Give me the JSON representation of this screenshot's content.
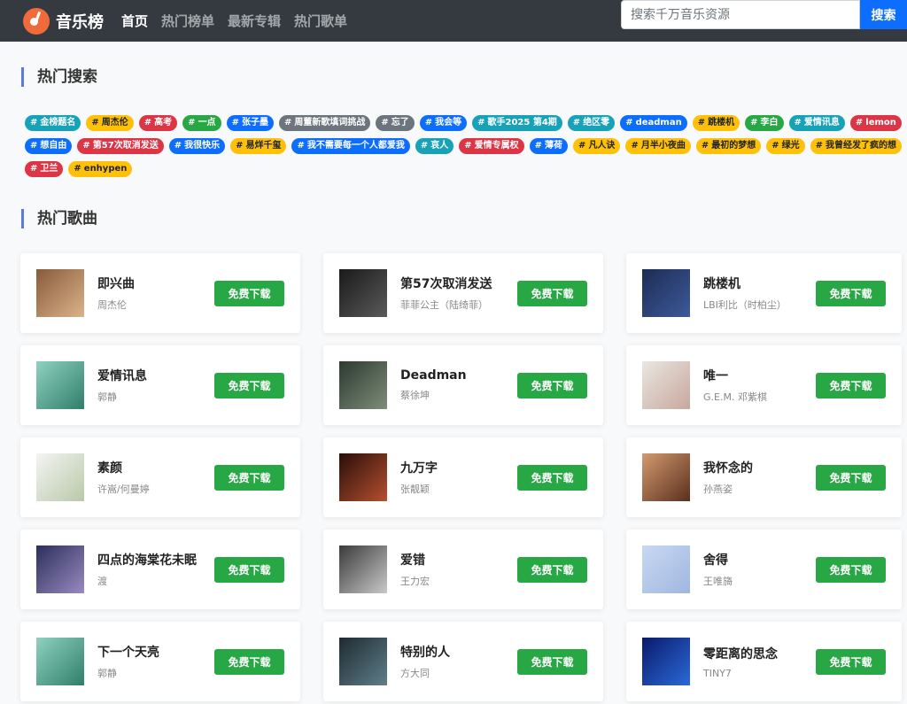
{
  "header": {
    "brand": "音乐榜",
    "nav": [
      {
        "label": "首页",
        "active": true
      },
      {
        "label": "热门榜单",
        "active": false
      },
      {
        "label": "最新专辑",
        "active": false
      },
      {
        "label": "热门歌单",
        "active": false
      }
    ],
    "search": {
      "placeholder": "搜索千万音乐资源",
      "button": "搜索"
    }
  },
  "hot_search": {
    "title": "热门搜索",
    "tags": [
      {
        "text": "金榜题名",
        "color": "teal"
      },
      {
        "text": "周杰伦",
        "color": "yellow"
      },
      {
        "text": "高考",
        "color": "red"
      },
      {
        "text": "一点",
        "color": "green"
      },
      {
        "text": "张子墨",
        "color": "blue"
      },
      {
        "text": "周董新歌填词挑战",
        "color": "gray"
      },
      {
        "text": "忘了",
        "color": "gray"
      },
      {
        "text": "我会等",
        "color": "blue"
      },
      {
        "text": "歌手2025 第4期",
        "color": "teal"
      },
      {
        "text": "绝区零",
        "color": "teal"
      },
      {
        "text": "deadman",
        "color": "blue"
      },
      {
        "text": "跳楼机",
        "color": "yellow"
      },
      {
        "text": "李白",
        "color": "green"
      },
      {
        "text": "爱情讯息",
        "color": "teal"
      },
      {
        "text": "lemon",
        "color": "red"
      },
      {
        "text": "想自由",
        "color": "blue"
      },
      {
        "text": "第57次取消发送",
        "color": "red"
      },
      {
        "text": "我很快乐",
        "color": "blue"
      },
      {
        "text": "易烊千玺",
        "color": "yellow"
      },
      {
        "text": "我不需要每一个人都爱我",
        "color": "blue"
      },
      {
        "text": "哀人",
        "color": "teal"
      },
      {
        "text": "爱情专属权",
        "color": "red"
      },
      {
        "text": "薄荷",
        "color": "blue"
      },
      {
        "text": "凡人诀",
        "color": "yellow"
      },
      {
        "text": "月半小夜曲",
        "color": "yellow"
      },
      {
        "text": "最初的梦想",
        "color": "yellow"
      },
      {
        "text": "绿光",
        "color": "yellow"
      },
      {
        "text": "我曾经发了疯的想",
        "color": "yellow"
      },
      {
        "text": "卫兰",
        "color": "red"
      },
      {
        "text": "enhypen",
        "color": "yellow"
      }
    ]
  },
  "hot_songs": {
    "title": "热门歌曲",
    "download_label": "免费下载",
    "items": [
      {
        "title": "即兴曲",
        "artist": "周杰伦",
        "cover": [
          "#8a5a3a",
          "#d9b48a"
        ]
      },
      {
        "title": "第57次取消发送",
        "artist": "菲菲公主（陆绮菲）",
        "cover": [
          "#1a1a1a",
          "#5a5a5a"
        ]
      },
      {
        "title": "跳楼机",
        "artist": "LBI利比（时柏尘）",
        "cover": [
          "#1d2c55",
          "#3d5a9a"
        ]
      },
      {
        "title": "爱情讯息",
        "artist": "郭静",
        "cover": [
          "#8fd1c0",
          "#2f7f6a"
        ]
      },
      {
        "title": "Deadman",
        "artist": "蔡徐坤",
        "cover": [
          "#2c3a30",
          "#7e8c78"
        ]
      },
      {
        "title": "唯一",
        "artist": "G.E.M. 邓紫棋",
        "cover": [
          "#eae6e2",
          "#c7a89b"
        ]
      },
      {
        "title": "素颜",
        "artist": "许嵩/何曼婷",
        "cover": [
          "#f4f4f4",
          "#b9c9a8"
        ]
      },
      {
        "title": "九万字",
        "artist": "张靓颖",
        "cover": [
          "#2a0e0a",
          "#b5502e"
        ]
      },
      {
        "title": "我怀念的",
        "artist": "孙燕姿",
        "cover": [
          "#d29a6e",
          "#5a2f1e"
        ]
      },
      {
        "title": "四点的海棠花未眠",
        "artist": "渡",
        "cover": [
          "#2b2f5a",
          "#9a8ac0"
        ]
      },
      {
        "title": "爱错",
        "artist": "王力宏",
        "cover": [
          "#3a3a3a",
          "#c9c9c9"
        ]
      },
      {
        "title": "舍得",
        "artist": "王唯旖",
        "cover": [
          "#c9d9f2",
          "#9fb6e0"
        ]
      },
      {
        "title": "下一个天亮",
        "artist": "郭静",
        "cover": [
          "#8fd1c0",
          "#2f7f6a"
        ]
      },
      {
        "title": "特别的人",
        "artist": "方大同",
        "cover": [
          "#1e2a30",
          "#5f7f8a"
        ]
      },
      {
        "title": "零距离的思念",
        "artist": "TINY7",
        "cover": [
          "#0a1a6a",
          "#2a6ad8"
        ]
      }
    ]
  },
  "colors": {
    "nav_bg": "#343a40",
    "download": "#28a745",
    "search": "#0d6efd"
  }
}
